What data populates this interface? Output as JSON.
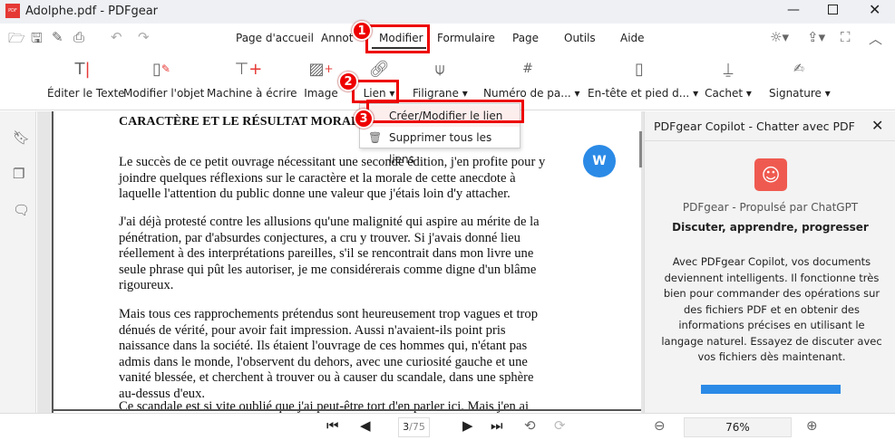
{
  "window": {
    "title": "Adolphe.pdf - PDFgear",
    "logo_text": "PDF"
  },
  "menu_tabs": [
    "Page d'accueil",
    "Annoter",
    "Modifier",
    "Formulaire",
    "Page",
    "Outils",
    "Aide"
  ],
  "active_tab": "Modifier",
  "ribbon": [
    {
      "label": "Éditer le Texte",
      "icon": "edit-text-icon"
    },
    {
      "label": "Modifier l'objet",
      "icon": "edit-object-icon"
    },
    {
      "label": "Machine à écrire",
      "icon": "typewriter-icon"
    },
    {
      "label": "Image",
      "icon": "image-add-icon"
    },
    {
      "label": "Lien",
      "icon": "link-icon"
    },
    {
      "label": "Filigrane",
      "icon": "watermark-icon"
    },
    {
      "label": "Numéro de pa...",
      "icon": "page-number-icon"
    },
    {
      "label": "En-tête et pied d...",
      "icon": "header-footer-icon"
    },
    {
      "label": "Cachet",
      "icon": "stamp-icon"
    },
    {
      "label": "Signature",
      "icon": "signature-icon"
    }
  ],
  "link_menu": {
    "items": [
      "Créer/Modifier le lien",
      "Supprimer tous les liens"
    ]
  },
  "annotations": [
    "1",
    "2",
    "3"
  ],
  "document": {
    "heading": "CARACTÈRE ET LE RÉSULTAT MORAL",
    "paragraphs": [
      [
        "Le succès de ce petit ouvrage nécessitant une seconde édition, j'en profite pour y",
        "joindre quelques réflexions sur le caractère et la morale de cette anecdote à",
        "laquelle l'attention du public donne une valeur que j'étais loin d'y attacher."
      ],
      [
        "J'ai déjà protesté contre les allusions qu'une malignité qui aspire au mérite de la",
        "pénétration, par d'absurdes conjectures, a cru y trouver. Si j'avais donné lieu",
        "réellement à des interprétations pareilles, s'il se rencontrait dans mon livre une",
        "seule phrase qui pût les autoriser, je me considérerais comme digne d'un blâme",
        "rigoureux."
      ],
      [
        "Mais tous ces rapprochements prétendus sont heureusement trop vagues et trop",
        "dénués de vérité, pour avoir fait impression. Aussi n'avaient-ils point pris",
        "naissance dans la société. Ils étaient l'ouvrage de ces hommes qui, n'étant pas",
        "admis dans le monde, l'observent du dehors, avec une curiosité gauche et une",
        "vanité blessée, et cherchent à trouver ou à causer du scandale, dans une sphère",
        "au-dessus d'eux."
      ],
      [
        "Ce scandale est si vite oublié que j'ai peut-être tort d'en parler ici. Mais j'en ai"
      ]
    ]
  },
  "copilot": {
    "title": "PDFgear Copilot - Chatter avec PDF",
    "powered": "PDFgear - Propulsé par ChatGPT",
    "tagline": "Discuter, apprendre, progresser",
    "description": "Avec PDFgear Copilot, vos documents deviennent intelligents.  Il fonctionne très bien pour commander des opérations sur des fichiers PDF et en obtenir des informations précises en utilisant le langage naturel.  Essayez de discuter avec vos fichiers dès maintenant."
  },
  "bottom": {
    "page_input": "3",
    "page_total": "/75",
    "zoom": "76%"
  },
  "colors": {
    "accent": "#2b8ae6",
    "annotation": "#e00000",
    "icon_red": "#e53935",
    "copilot_logo": "#ef5a50"
  }
}
